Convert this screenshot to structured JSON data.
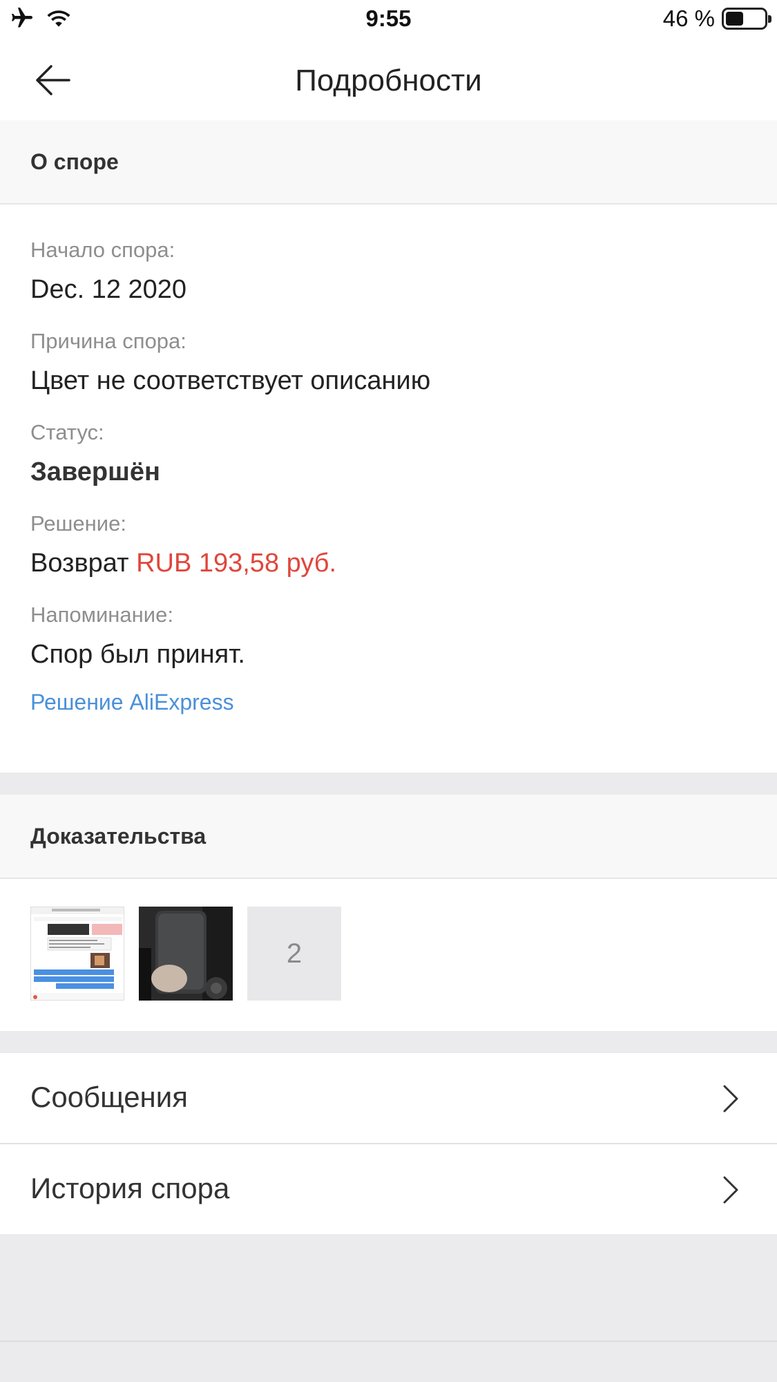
{
  "status_bar": {
    "time": "9:55",
    "battery_text": "46 %",
    "battery_level": 0.46,
    "icons": [
      "airplane-icon",
      "wifi-icon",
      "battery-icon"
    ]
  },
  "nav": {
    "title": "Подробности",
    "back_icon": "arrow-left-icon"
  },
  "dispute": {
    "section_title": "О споре",
    "start_label": "Начало спора:",
    "start_value": "Dec. 12 2020",
    "reason_label": "Причина спора:",
    "reason_value": "Цвет не соответствует описанию",
    "status_label": "Статус:",
    "status_value": "Завершён",
    "decision_label": "Решение:",
    "decision_prefix": "Возврат",
    "decision_amount": "RUB 193,58 руб.",
    "reminder_label": "Напоминание:",
    "reminder_value": "Спор был принят.",
    "link_label": "Решение AliExpress"
  },
  "evidence": {
    "section_title": "Доказательства",
    "more_count": "2"
  },
  "menu": {
    "messages_label": "Сообщения",
    "history_label": "История спора"
  },
  "colors": {
    "accent_red": "#e0463c",
    "link_blue": "#4a90d9",
    "background_gray": "#ebebed"
  }
}
